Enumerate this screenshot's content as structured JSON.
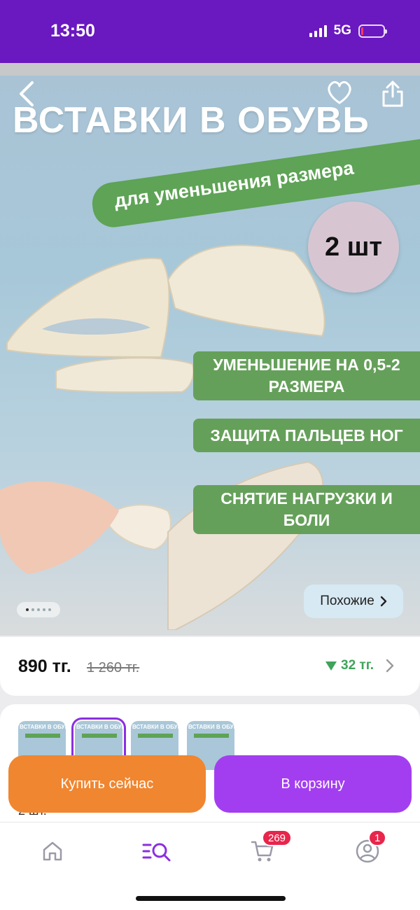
{
  "status": {
    "time": "13:50",
    "network": "5G"
  },
  "hero": {
    "title": "ВСТАВКИ В ОБУВЬ",
    "ribbon": "для уменьшения размера",
    "count_badge": "2 шт",
    "features": [
      "УМЕНЬШЕНИЕ НА 0,5-2 РАЗМЕРА",
      "ЗАЩИТА ПАЛЬЦЕВ НОГ",
      "СНЯТИЕ НАГРУЗКИ И БОЛИ"
    ],
    "similar_label": "Похожие",
    "slides_total": 5,
    "slide_active": 1
  },
  "price": {
    "current": "890 тг.",
    "old": "1 260 тг.",
    "discount": "32 тг."
  },
  "variants": {
    "thumbs": [
      "ВСТАВКИ В ОБУВЬ",
      "ВСТАВКИ В ОБУВЬ",
      "ВСТАВКИ В ОБУВЬ",
      "ВСТАВКИ В ОБУВЬ"
    ],
    "selected_index": 1,
    "below_text": "2 шт."
  },
  "actions": {
    "buy_now": "Купить сейчас",
    "add_to_cart": "В корзину"
  },
  "tabbar": {
    "cart_badge": "269",
    "profile_badge": "1"
  },
  "colors": {
    "brand": "#6a18c0",
    "buy": "#f08630",
    "cart": "#a33ef0",
    "discount": "#3fa35b",
    "badge": "#e8254b"
  }
}
